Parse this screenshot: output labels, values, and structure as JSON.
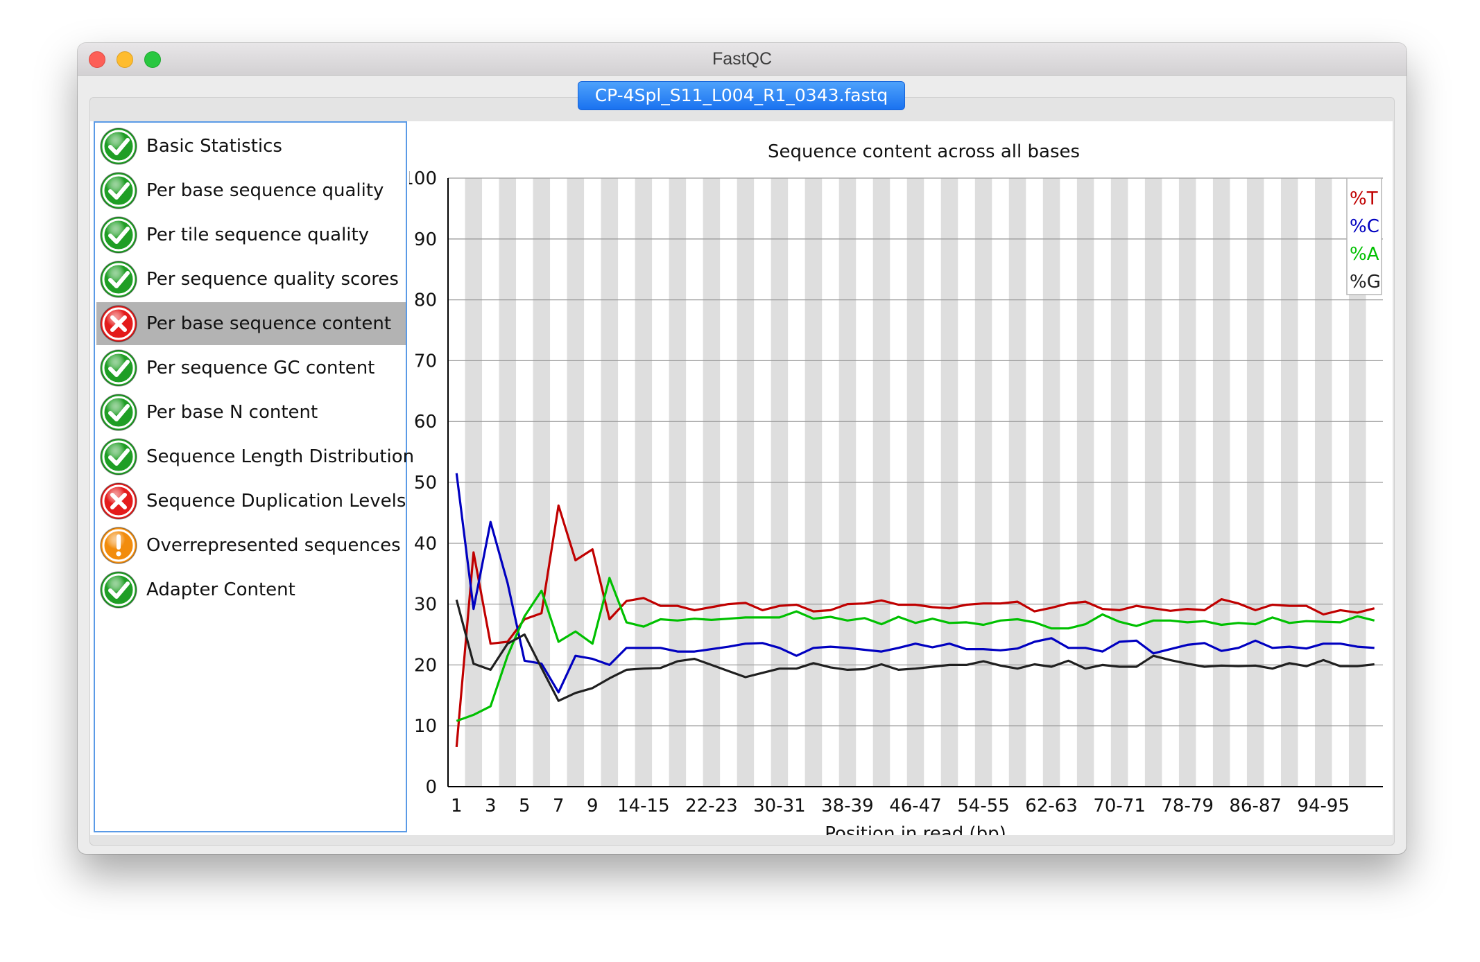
{
  "window": {
    "title": "FastQC"
  },
  "file_tab": {
    "label": "CP-4Spl_S11_L004_R1_0343.fastq"
  },
  "colors": {
    "pass": "#1f9e25",
    "fail": "#e41b1b",
    "warn": "#f28c0c",
    "selected_bg": "#b3b3b3"
  },
  "modules": [
    {
      "label": "Basic Statistics",
      "status": "pass",
      "icon": "check-icon"
    },
    {
      "label": "Per base sequence quality",
      "status": "pass",
      "icon": "check-icon"
    },
    {
      "label": "Per tile sequence quality",
      "status": "pass",
      "icon": "check-icon"
    },
    {
      "label": "Per sequence quality scores",
      "status": "pass",
      "icon": "check-icon"
    },
    {
      "label": "Per base sequence content",
      "status": "fail",
      "icon": "cross-icon",
      "selected": true
    },
    {
      "label": "Per sequence GC content",
      "status": "pass",
      "icon": "check-icon"
    },
    {
      "label": "Per base N content",
      "status": "pass",
      "icon": "check-icon"
    },
    {
      "label": "Sequence Length Distribution",
      "status": "pass",
      "icon": "check-icon"
    },
    {
      "label": "Sequence Duplication Levels",
      "status": "fail",
      "icon": "cross-icon"
    },
    {
      "label": "Overrepresented sequences",
      "status": "warn",
      "icon": "exclamation-icon"
    },
    {
      "label": "Adapter Content",
      "status": "pass",
      "icon": "check-icon"
    }
  ],
  "chart_data": {
    "type": "line",
    "title": "Sequence content across all bases",
    "xlabel": "Position in read (bp)",
    "ylabel": "",
    "ylim": [
      0,
      100
    ],
    "yticks": [
      0,
      10,
      20,
      30,
      40,
      50,
      60,
      70,
      80,
      90,
      100
    ],
    "x_tick_labels": [
      "1",
      "3",
      "5",
      "7",
      "9",
      "14-15",
      "22-23",
      "30-31",
      "38-39",
      "46-47",
      "54-55",
      "62-63",
      "70-71",
      "78-79",
      "86-87",
      "94-95"
    ],
    "x_tick_indices": [
      0,
      2,
      4,
      6,
      8,
      11,
      15,
      19,
      23,
      27,
      31,
      35,
      39,
      43,
      47,
      51
    ],
    "grid": true,
    "legend_position": "top-right",
    "series": [
      {
        "name": "%T",
        "color": "#c00000",
        "values": [
          6.5,
          38.5,
          23.5,
          23.8,
          27.5,
          28.5,
          46.2,
          37.2,
          39.0,
          27.5,
          30.5,
          31.0,
          29.7,
          29.7,
          29.0,
          29.5,
          30.0,
          30.2,
          29.0,
          29.7,
          29.9,
          28.8,
          29.0,
          30.0,
          30.1,
          30.6,
          29.9,
          29.9,
          29.5,
          29.3,
          29.9,
          30.1,
          30.1,
          30.4,
          28.8,
          29.4,
          30.1,
          30.4,
          29.2,
          29.0,
          29.7,
          29.3,
          28.9,
          29.2,
          29.0,
          30.8,
          30.1,
          29.0,
          29.9,
          29.7,
          29.7,
          28.3,
          29.0,
          28.6,
          29.3
        ]
      },
      {
        "name": "%C",
        "color": "#0000c0",
        "values": [
          51.5,
          29.2,
          43.5,
          33.5,
          20.7,
          20.2,
          15.5,
          21.5,
          21.0,
          20.0,
          22.8,
          22.8,
          22.8,
          22.2,
          22.2,
          22.6,
          23.0,
          23.5,
          23.6,
          22.8,
          21.5,
          22.8,
          23.0,
          22.8,
          22.5,
          22.2,
          22.8,
          23.5,
          22.9,
          23.5,
          22.6,
          22.6,
          22.4,
          22.7,
          23.8,
          24.4,
          22.8,
          22.8,
          22.2,
          23.8,
          24.0,
          21.9,
          22.6,
          23.3,
          23.6,
          22.3,
          22.8,
          24.0,
          22.8,
          23.0,
          22.7,
          23.5,
          23.5,
          23.0,
          22.8
        ]
      },
      {
        "name": "%A",
        "color": "#00c000",
        "values": [
          10.8,
          11.8,
          13.2,
          21.5,
          28.0,
          32.2,
          23.8,
          25.5,
          23.5,
          34.3,
          27.0,
          26.3,
          27.5,
          27.3,
          27.6,
          27.4,
          27.6,
          27.8,
          27.8,
          27.8,
          28.8,
          27.6,
          27.9,
          27.3,
          27.7,
          26.7,
          27.9,
          26.9,
          27.6,
          26.9,
          27.0,
          26.6,
          27.3,
          27.5,
          27.0,
          26.0,
          26.0,
          26.7,
          28.3,
          27.1,
          26.4,
          27.3,
          27.3,
          27.0,
          27.2,
          26.6,
          26.9,
          26.7,
          27.8,
          26.9,
          27.2,
          27.1,
          27.0,
          28.0,
          27.3
        ]
      },
      {
        "name": "%G",
        "color": "#202020",
        "values": [
          30.7,
          20.2,
          19.2,
          23.5,
          25.0,
          19.5,
          14.1,
          15.4,
          16.2,
          17.8,
          19.2,
          19.4,
          19.5,
          20.6,
          21.0,
          20.0,
          19.0,
          18.0,
          18.7,
          19.4,
          19.4,
          20.3,
          19.6,
          19.2,
          19.3,
          20.1,
          19.2,
          19.4,
          19.7,
          20.0,
          20.0,
          20.6,
          19.9,
          19.4,
          20.1,
          19.7,
          20.7,
          19.4,
          20.0,
          19.7,
          19.7,
          21.5,
          20.8,
          20.2,
          19.7,
          19.9,
          19.8,
          19.9,
          19.4,
          20.3,
          19.8,
          20.8,
          19.8,
          19.8,
          20.1
        ]
      }
    ]
  }
}
